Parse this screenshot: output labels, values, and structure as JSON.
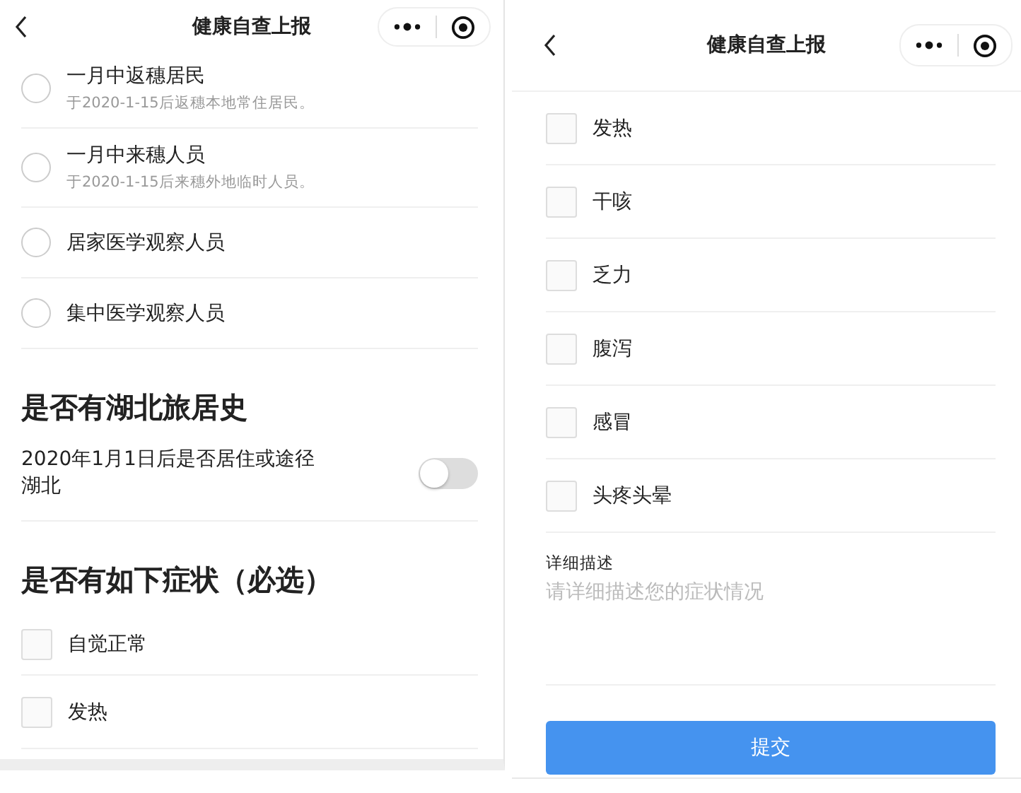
{
  "screens": [
    {
      "nav": {
        "title": "健康自查上报"
      },
      "blocks": [
        {
          "kind": "radio",
          "label": "一月中返穗居民",
          "note": "于2020-1-15后返穗本地常住居民。",
          "selected": false
        },
        {
          "kind": "radio",
          "label": "一月中来穗人员",
          "note": "于2020-1-15后来穗外地临时人员。",
          "selected": false
        },
        {
          "kind": "radio",
          "label": "居家医学观察人员",
          "selected": false
        },
        {
          "kind": "radio",
          "label": "集中医学观察人员",
          "selected": false
        },
        {
          "kind": "heading",
          "label": "是否有湖北旅居史"
        },
        {
          "kind": "toggle",
          "label": "2020年1月1日后是否居住或途径湖北",
          "on": false
        },
        {
          "kind": "heading",
          "label": "是否有如下症状（必选）"
        },
        {
          "kind": "checkbox",
          "label": "自觉正常",
          "checked": false
        },
        {
          "kind": "checkbox",
          "label": "发热",
          "checked": false
        }
      ]
    },
    {
      "nav": {
        "title": "健康自查上报"
      },
      "blocks": [
        {
          "kind": "checkbox",
          "label": "发热",
          "checked": false
        },
        {
          "kind": "checkbox",
          "label": "干咳",
          "checked": false
        },
        {
          "kind": "checkbox",
          "label": "乏力",
          "checked": false
        },
        {
          "kind": "checkbox",
          "label": "腹泻",
          "checked": false
        },
        {
          "kind": "checkbox",
          "label": "感冒",
          "checked": false
        },
        {
          "kind": "checkbox",
          "label": "头疼头晕",
          "checked": false
        },
        {
          "kind": "textarea",
          "label": "详细描述",
          "placeholder": "请详细描述您的症状情况"
        },
        {
          "kind": "button",
          "label": "提交"
        }
      ]
    }
  ]
}
